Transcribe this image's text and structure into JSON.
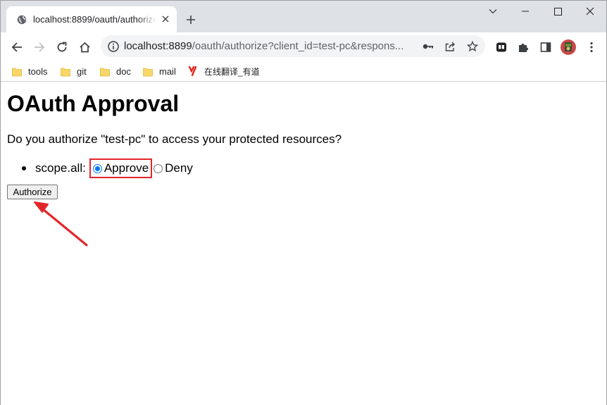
{
  "browser": {
    "tab": {
      "title": "localhost:8899/oauth/authorize?client_id=test-pc"
    },
    "url": {
      "host": "localhost:8899",
      "path": "/oauth/authorize?client_id=test-pc&respons..."
    },
    "bookmarks": [
      {
        "label": "tools",
        "icon": "folder-icon"
      },
      {
        "label": "git",
        "icon": "folder-icon"
      },
      {
        "label": "doc",
        "icon": "folder-icon"
      },
      {
        "label": "mail",
        "icon": "folder-icon"
      },
      {
        "label": "在线翻译_有道",
        "icon": "youdao-icon"
      }
    ]
  },
  "page": {
    "heading": "OAuth Approval",
    "question": "Do you authorize \"test-pc\" to access your protected resources?",
    "scope": {
      "label": "scope.all:",
      "options": [
        {
          "label": "Approve",
          "checked": true
        },
        {
          "label": "Deny",
          "checked": false
        }
      ]
    },
    "submit_label": "Authorize"
  },
  "annotations": {
    "highlight_color": "#e3262b"
  }
}
